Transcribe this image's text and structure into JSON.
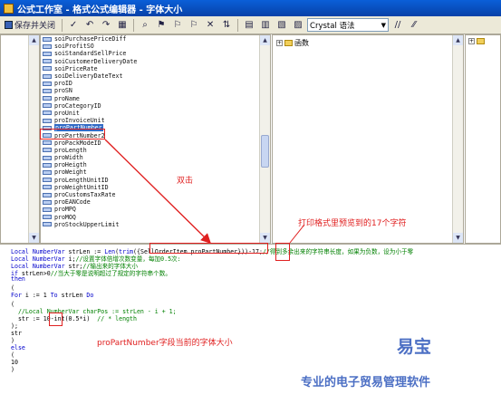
{
  "window": {
    "title": "公式工作室 - 格式公式编辑器 - 字体大小"
  },
  "toolbar": {
    "save_close_label": "保存并关闭",
    "syntax_select_value": "Crystal 语法",
    "comment_label": "//"
  },
  "fields": [
    "soiPurchasePriceDiff",
    "soiProfitSO",
    "soiStandardSellPrice",
    "soiCustomerDeliveryDate",
    "soiPriceRate",
    "soiDeliveryDateText",
    "proID",
    "proSN",
    "proName",
    "proCategoryID",
    "proUnit",
    "proInvoiceUnit",
    "proPartNumber",
    "proPartNumber2",
    "proPackModeID",
    "proLength",
    "proWidth",
    "proHeigth",
    "proWeight",
    "proLengthUnitID",
    "proWeightUnitID",
    "proCustomsTaxRate",
    "proEANCode",
    "proMPQ",
    "proMOQ",
    "proStockUpperLimit"
  ],
  "functions_tree": {
    "root_label": "函数"
  },
  "code": {
    "l1": {
      "a": "Local NumberVar",
      "b": " strLen := ",
      "c": "Len",
      "d": "(",
      "e": "trim",
      "f": "(",
      "g": "{SellOrderItem.proPartNumber}",
      "h": "))-17;",
      "i": "//得到多余出来的字符串长度，如果为负数，设为小于零"
    },
    "l2": {
      "a": "Local NumberVar",
      "b": " i;",
      "c": "//设置字体倍增次数变量，每加0.5次:"
    },
    "l3": {
      "a": "Local NumberVar",
      "b": " str;",
      "c": "//输出来的字体大小"
    },
    "l4": {
      "a": "if",
      "b": " strLen>0",
      "c": "//当大于零是说明超过了规定的字符串个数。"
    },
    "l5": "then",
    "l6": "(",
    "l7": {
      "a": "For",
      "b": " i := 1 ",
      "c": "To",
      "d": " strLen ",
      "e": "Do"
    },
    "l8": "(",
    "l9": "  //Local NumberVar charPos := strLen - i + 1;",
    "l10": {
      "a": "  str := ",
      "b": "10",
      "c": "-int(0.5*i)",
      "d": "  // * length"
    },
    "l11": ");",
    "l12": "str",
    "l13": ")",
    "l14": "else",
    "l15": "(",
    "l16": "10",
    "l17": ")"
  },
  "annotations": {
    "double_click": "双击",
    "preview_chars": "打印格式里预览到的17个字符",
    "font_size_label": "proPartNumber字段当前的字体大小"
  },
  "branding": {
    "title": "易宝",
    "slogan": "专业的电子贸易管理软件"
  },
  "colors": {
    "annotation_red": "#e02020",
    "brand_blue": "#4c6fc4",
    "keyword_blue": "#0000cc",
    "comment_green": "#008000"
  }
}
